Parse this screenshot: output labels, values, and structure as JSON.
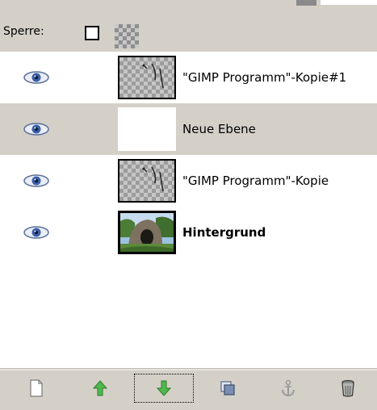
{
  "lock": {
    "label": "Sperre:",
    "icons": [
      "lock-pixels-checkbox",
      "lock-alpha-icon"
    ]
  },
  "layers": [
    {
      "name": "\"GIMP Programm\"-Kopie#1",
      "visible": true,
      "thumbnail": "transparent-with-glyph",
      "selected": false
    },
    {
      "name": "Neue Ebene",
      "visible": true,
      "thumbnail": "white",
      "selected": false
    },
    {
      "name": "\"GIMP Programm\"-Kopie",
      "visible": true,
      "thumbnail": "transparent-with-glyph",
      "selected": false
    },
    {
      "name": "Hintergrund",
      "visible": true,
      "thumbnail": "photo",
      "selected": false,
      "bold": true
    }
  ],
  "toolbar": {
    "buttons": [
      {
        "name": "new-layer",
        "icon": "new-page-icon"
      },
      {
        "name": "raise-layer",
        "icon": "arrow-up-icon"
      },
      {
        "name": "lower-layer",
        "icon": "arrow-down-icon",
        "focused": true
      },
      {
        "name": "duplicate-layer",
        "icon": "duplicate-icon"
      },
      {
        "name": "anchor-layer",
        "icon": "anchor-icon"
      },
      {
        "name": "delete-layer",
        "icon": "trash-icon"
      }
    ]
  },
  "colors": {
    "panel": "#d4d0c8",
    "row_alt": "#d4d0c8",
    "eye_iris": "#3a5fa8",
    "arrow_green": "#4fb84a"
  }
}
